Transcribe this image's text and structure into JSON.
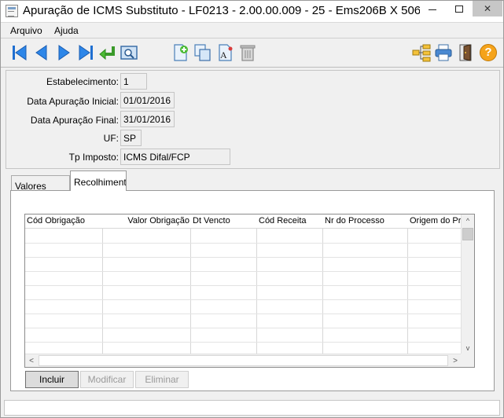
{
  "window": {
    "title": "Apuração de ICMS Substituto - LF0213 - 2.00.00.009 - 25 - Ems206B X 506 ...",
    "close_glyph": "✕"
  },
  "menu": {
    "items": [
      "Arquivo",
      "Ajuda"
    ]
  },
  "toolbar": {
    "icons": [
      "first-record-icon",
      "previous-record-icon",
      "next-record-icon",
      "last-record-icon",
      "goto-icon",
      "search-icon",
      "new-record-icon",
      "copy-record-icon",
      "edit-record-icon",
      "delete-record-icon",
      "hierarchy-icon",
      "print-icon",
      "exit-icon",
      "help-icon"
    ],
    "help_label": "?"
  },
  "form": {
    "fields": [
      {
        "label": "Estabelecimento:",
        "value": "1"
      },
      {
        "label": "Data Apuração Inicial:",
        "value": "01/01/2016"
      },
      {
        "label": "Data Apuração Final:",
        "value": "31/01/2016"
      },
      {
        "label": "UF:",
        "value": "SP"
      },
      {
        "label": "Tp Imposto:",
        "value": "ICMS Difal/FCP"
      }
    ]
  },
  "tabs": [
    {
      "label": "Valores",
      "active": false
    },
    {
      "label": "Recolhimento",
      "active": true
    }
  ],
  "grid": {
    "columns": [
      "Cód Obrigação",
      "Valor Obrigação",
      "Dt Vencto",
      "Cód Receita",
      "Nr do Processo",
      "Origem do Pro"
    ],
    "rows": [],
    "scroll_up": "^",
    "scroll_down": "v",
    "scroll_left": "<",
    "scroll_right": ">"
  },
  "actions": {
    "include_label": "Incluir",
    "modify_label": "Modificar",
    "delete_label": "Eliminar"
  }
}
